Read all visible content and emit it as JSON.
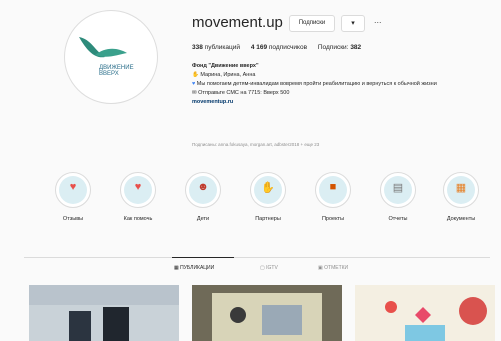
{
  "profile": {
    "username": "movement.up",
    "follow_button": "Подписки",
    "dropdown": "▾",
    "more": "...",
    "logo_text": [
      "ДВИЖЕНИЕ",
      "ВВЕРХ"
    ],
    "stats": {
      "posts_value": "338",
      "posts_label": "публикаций",
      "followers_value": "4 169",
      "followers_label": "подписчиков",
      "following_label": "Подписки:",
      "following_value": "382"
    },
    "bio": {
      "name": "Фонд \"Движение вверх\"",
      "line1": "Марина, Ирина, Анна",
      "line2": "Мы помогаем детям-инвалидам вовремя пройти реабилитацию и вернуться к обычной жизни",
      "line3": "Отправьте СМС на 7715: Вверх 500",
      "link": "movementup.ru"
    },
    "followed_by": "Подписаны: anna.fokusaya, morgan.art, adbster2018 + еще 23"
  },
  "highlights": [
    {
      "label": "Отзывы",
      "icon": "heart-icon"
    },
    {
      "label": "Как помочь",
      "icon": "heart-hand-icon"
    },
    {
      "label": "Дети",
      "icon": "kids-icon"
    },
    {
      "label": "Партнеры",
      "icon": "handshake-icon"
    },
    {
      "label": "Проекты",
      "icon": "cube-icon"
    },
    {
      "label": "Отчеты",
      "icon": "report-icon"
    },
    {
      "label": "Документы",
      "icon": "document-icon"
    }
  ],
  "tabs": [
    "ПУБЛИКАЦИИ",
    "IGTV",
    "ОТМЕТКИ"
  ],
  "colors": {
    "accent": "#e8504b",
    "highlight_bg": "#dbeef3",
    "link": "#00376b"
  }
}
